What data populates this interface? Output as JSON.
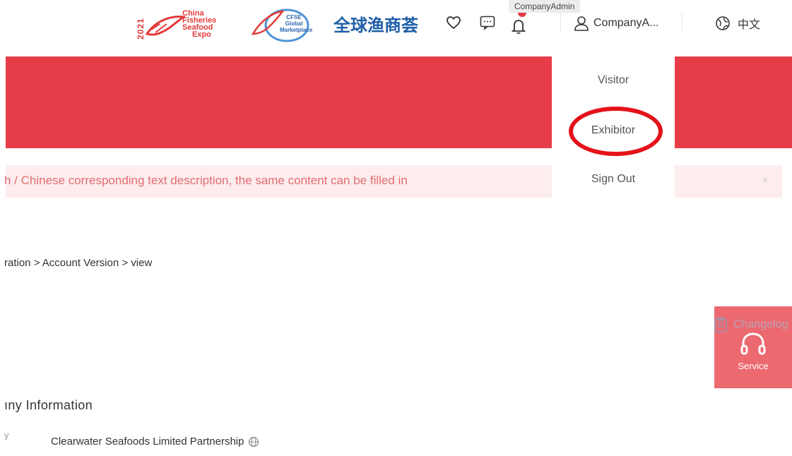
{
  "header": {
    "expo_logo": {
      "year": "2021",
      "line1": "China",
      "line2": "Fisheries",
      "line3": "Seafood",
      "line4": "Expo"
    },
    "cfse_logo": {
      "line1": "CFSE",
      "line2": "Global",
      "line3": "Marketplace"
    },
    "cn_logo": "全球渔商荟",
    "tooltip": "CompanyAdmin",
    "user_label": "CompanyA...",
    "language": "中文",
    "colors": {
      "accent": "#e63d48",
      "brand_blue": "#1f5fa8"
    }
  },
  "icons": {
    "favorites": "heart-icon",
    "messages": "chat-icon",
    "notifications": "bell-icon",
    "user": "user-icon",
    "language": "globe-icon",
    "service": "headset-icon",
    "changelog": "clipboard-icon"
  },
  "notice": {
    "text": "h / Chinese corresponding text description, the same content can be filled in",
    "close": "×"
  },
  "menu": {
    "items": [
      "Visitor",
      "Exhibitor",
      "Sign Out"
    ]
  },
  "breadcrumb": "ration > Account Version > view",
  "service": {
    "label": "Service",
    "changelog": "Changelog"
  },
  "company": {
    "section_title": "ıny Information",
    "row_label": "y",
    "name": "Clearwater Seafoods Limited Partnership"
  }
}
